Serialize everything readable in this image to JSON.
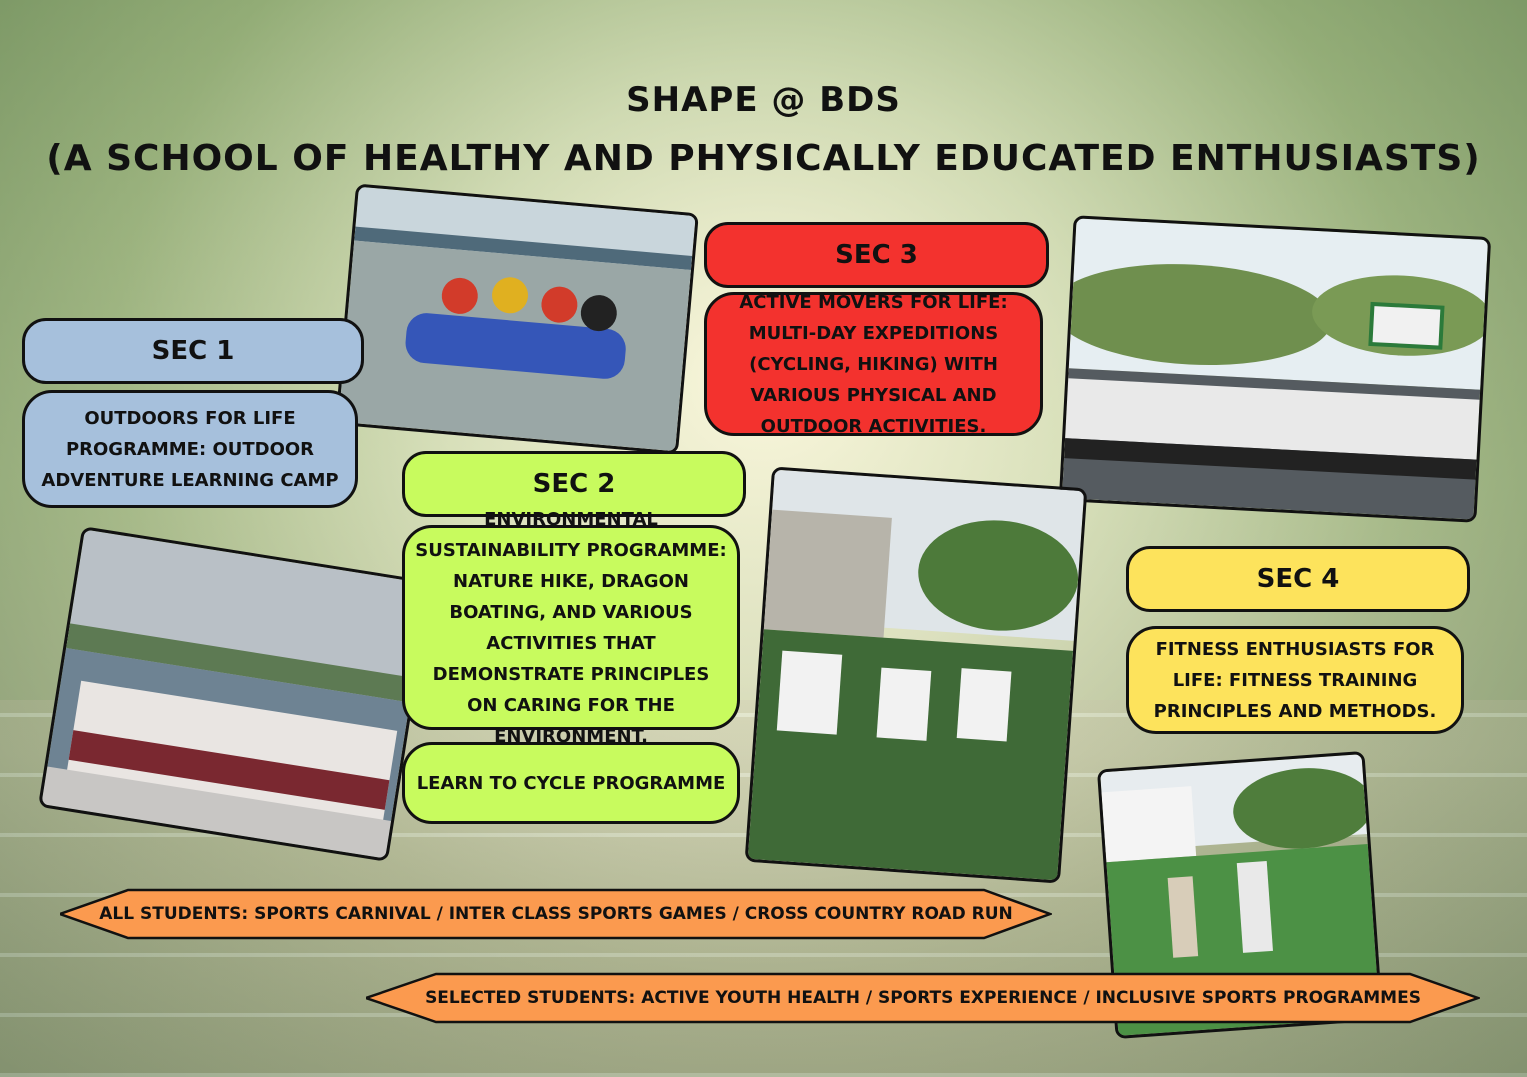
{
  "title": {
    "line1": "SHAPE @ BDS",
    "line2": "(A SCHOOL OF HEALTHY AND PHYSICALLY EDUCATED ENTHUSIASTS)"
  },
  "sec1": {
    "label": "SEC 1",
    "text": "OUTDOORS FOR LIFE PROGRAMME: OUTDOOR ADVENTURE LEARNING CAMP",
    "color": "#a6c0dc"
  },
  "sec2": {
    "label": "SEC 2",
    "text": "ENVIRONMENTAL SUSTAINABILITY PROGRAMME: NATURE HIKE, DRAGON BOATING, AND VARIOUS ACTIVITIES THAT DEMONSTRATE PRINCIPLES ON CARING FOR THE ENVIRONMENT.",
    "text2": "LEARN TO CYCLE PROGRAMME",
    "color": "#c8fb5e"
  },
  "sec3": {
    "label": "SEC 3",
    "text": "ACTIVE MOVERS FOR LIFE: MULTI-DAY EXPEDITIONS (CYCLING, HIKING) WITH VARIOUS PHYSICAL AND OUTDOOR ACTIVITIES.",
    "color": "#f3322e"
  },
  "sec4": {
    "label": "SEC 4",
    "text": "FITNESS ENTHUSIASTS FOR LIFE: FITNESS TRAINING PRINCIPLES AND METHODS.",
    "color": "#fde35c"
  },
  "banners": {
    "all_students": "ALL STUDENTS: SPORTS CARNIVAL / INTER CLASS SPORTS GAMES / CROSS COUNTRY ROAD RUN",
    "selected_students": "SELECTED STUDENTS: ACTIVE YOUTH HEALTH / SPORTS EXPERIENCE / INCLUSIVE SPORTS PROGRAMMES",
    "color": "#fb9a4f"
  }
}
